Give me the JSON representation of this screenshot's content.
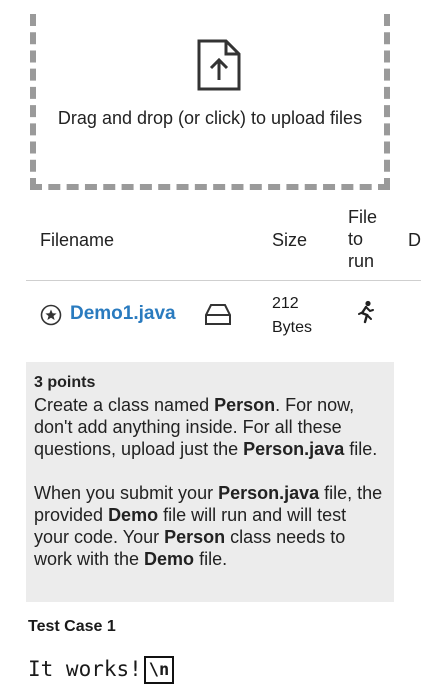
{
  "dropzone": {
    "icon": "upload-file-icon",
    "text": "Drag and drop (or click) to upload files"
  },
  "table": {
    "headers": {
      "filename": "Filename",
      "size": "Size",
      "run_line1": "File",
      "run_line2": "to",
      "run_line3": "run",
      "d": "D"
    },
    "rows": [
      {
        "filename": "Demo1.java",
        "size_line1": "212",
        "size_line2": "Bytes",
        "icons": [
          "star-circle-icon",
          "eraser-icon",
          "running-person-icon"
        ]
      }
    ]
  },
  "description": {
    "points": "3 points",
    "p1_a": "Create a class named ",
    "p1_b": "Person",
    "p1_c": ". For now, don't add anything inside. For all these questions, upload just the ",
    "p1_d": "Person.java",
    "p1_e": " file.",
    "p2_a": "When you submit your ",
    "p2_b": "Person.java",
    "p2_c": " file, the provided ",
    "p2_d": "Demo",
    "p2_e": " file will run and will test your code. Your ",
    "p2_f": "Person",
    "p2_g": " class needs to work with the ",
    "p2_h": "Demo",
    "p2_i": " file."
  },
  "test_case": {
    "title": "Test Case 1",
    "output": "It works!",
    "newline_marker": "\\n"
  },
  "colors": {
    "link": "#2a7bbf",
    "dash_border": "#9a9a9a",
    "desc_background": "#ececec"
  }
}
